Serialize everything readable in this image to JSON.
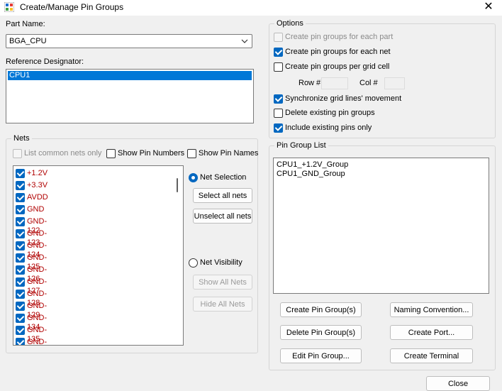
{
  "window": {
    "title": "Create/Manage Pin Groups",
    "close_glyph": "✕"
  },
  "part_name": {
    "label": "Part Name:",
    "value": "BGA_CPU"
  },
  "ref_des": {
    "label": "Reference Designator:",
    "items": [
      "CPU1"
    ]
  },
  "nets": {
    "title": "Nets",
    "list_common_label": "List common nets only",
    "show_pin_numbers_label": "Show Pin Numbers",
    "show_pin_names_label": "Show Pin Names",
    "items": [
      {
        "name": "+1.2V",
        "checked": true
      },
      {
        "name": "+3.3V",
        "checked": true
      },
      {
        "name": "AVDD",
        "checked": true
      },
      {
        "name": "GND",
        "checked": true
      },
      {
        "name": "GND-122",
        "checked": true
      },
      {
        "name": "GND-123",
        "checked": true
      },
      {
        "name": "GND-124",
        "checked": true
      },
      {
        "name": "GND-125",
        "checked": true
      },
      {
        "name": "GND-126",
        "checked": true
      },
      {
        "name": "GND-127",
        "checked": true
      },
      {
        "name": "GND-128",
        "checked": true
      },
      {
        "name": "GND-129",
        "checked": true
      },
      {
        "name": "GND-134",
        "checked": true
      },
      {
        "name": "GND-135",
        "checked": true
      },
      {
        "name": "GND-136",
        "checked": true
      }
    ],
    "net_selection_label": "Net Selection",
    "select_all_label": "Select all nets",
    "unselect_all_label": "Unselect all nets",
    "net_visibility_label": "Net Visibility",
    "show_all_label": "Show All Nets",
    "hide_all_label": "Hide All Nets"
  },
  "options": {
    "title": "Options",
    "per_part_label": "Create pin groups for each part",
    "per_net_label": "Create pin groups for each net",
    "per_grid_label": "Create pin groups per grid cell",
    "row_label": "Row #",
    "col_label": "Col #",
    "sync_label": "Synchronize grid lines' movement",
    "delete_existing_label": "Delete existing pin groups",
    "include_existing_label": "Include existing pins only"
  },
  "pin_group_list": {
    "title": "Pin Group List",
    "items": [
      "CPU1_+1.2V_Group",
      "CPU1_GND_Group"
    ]
  },
  "buttons": {
    "create_pin_group": "Create Pin Group(s)",
    "naming_convention": "Naming Convention...",
    "delete_pin_group": "Delete Pin Group(s)",
    "create_port": "Create Port...",
    "edit_pin_group": "Edit Pin Group...",
    "create_terminal": "Create Terminal",
    "close": "Close"
  }
}
